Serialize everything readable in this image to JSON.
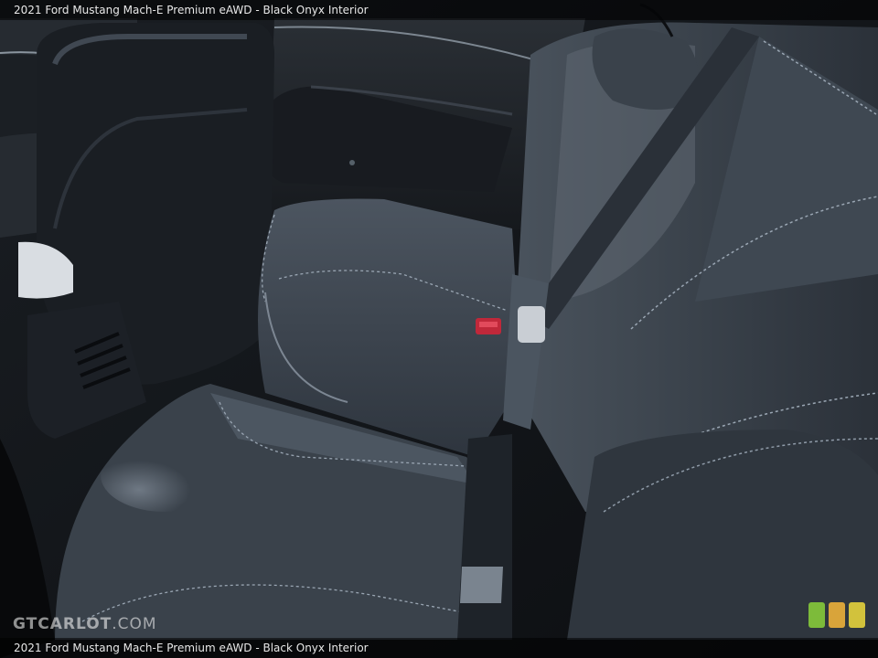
{
  "caption": {
    "top": "2021 Ford Mustang Mach-E Premium eAWD - Black Onyx Interior",
    "bottom": "2021 Ford Mustang Mach-E Premium eAWD - Black Onyx Interior"
  },
  "watermark": {
    "bold": "GTCARLOT",
    "light": ".COM"
  },
  "scene": {
    "subject": "rear-bench-seat",
    "palette": {
      "leather": "#3a424c",
      "leather_highlight": "#6f7984",
      "shadow": "#101318",
      "stitching": "#9aa6b3",
      "belt": "#2a3038",
      "buckle_red": "#c0283a"
    }
  },
  "badge": {
    "colors": [
      "#7dbb3a",
      "#d9a43a",
      "#d2c23c"
    ]
  }
}
